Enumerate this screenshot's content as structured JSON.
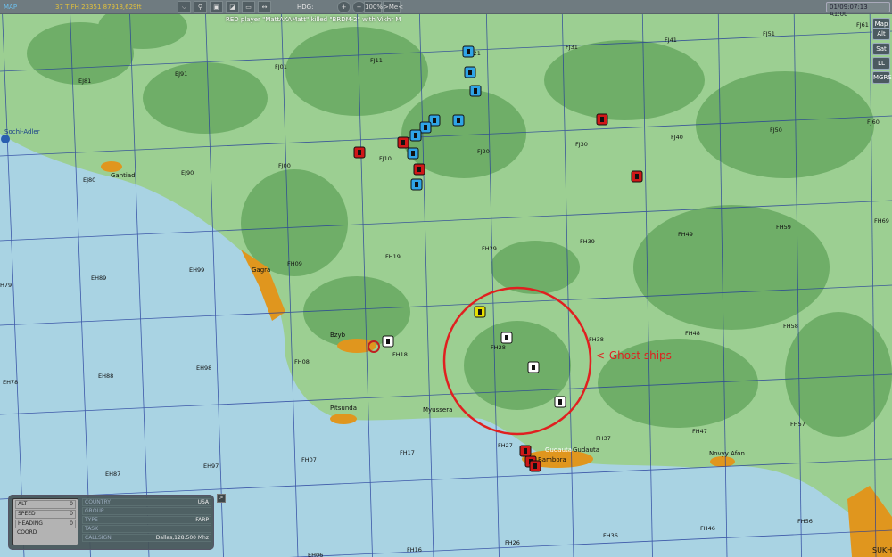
{
  "topbar": {
    "title": "MAP",
    "coords": "37 T FH 23351 87918,629ft",
    "hdg_label": "HDG:",
    "zoom_in": "+",
    "zoom_out": "−",
    "zoom_level": "100%",
    "me_button": ">Me<",
    "clock": "01/09:07:13 A1:00",
    "tools": [
      "ruler-icon",
      "measure-icon",
      "layers-icon",
      "marker-icon",
      "comment-icon",
      "distance-icon"
    ]
  },
  "message": "RED player \"MattAKAMatt\" killed \"BRDM-2\" with Vikhr M",
  "side_buttons": [
    "Map",
    "Alt",
    "Sat",
    "LL",
    "MGRS"
  ],
  "grid_labels": [
    "EJ81",
    "EJ91",
    "FJ01",
    "FJ11",
    "FJ21",
    "FJ31",
    "FJ41",
    "FJ51",
    "FJ61",
    "EJ80",
    "EJ90",
    "FJ00",
    "FJ10",
    "FJ20",
    "FJ30",
    "FJ40",
    "FJ50",
    "FJ60",
    "EH89",
    "EH99",
    "FH09",
    "FH19",
    "FH29",
    "FH39",
    "FH49",
    "FH59",
    "FH69",
    "EH78",
    "EH88",
    "EH98",
    "FH08",
    "FH18",
    "FH28",
    "FH38",
    "FH48",
    "FH58",
    "EH87",
    "EH97",
    "FH07",
    "FH17",
    "FH27",
    "FH37",
    "FH47",
    "FH57",
    "FH56",
    "FH46",
    "FH36",
    "FH26",
    "FH16",
    "EH06",
    "H79"
  ],
  "towns": [
    "Sochi-Adler",
    "Gantiadi",
    "Gagra",
    "Bzyb",
    "Pitsunda",
    "Myussera",
    "Gudauta",
    "Gudauta",
    "Bambora",
    "Novyy Afon",
    "SUKH"
  ],
  "annotation": "<-Ghost ships",
  "colors": {
    "sea": "#a9d3e3",
    "land": "#9ccf92",
    "forest": "#6fae68",
    "town": "#e0961e",
    "blue_unit": "#2fa4e6",
    "red_unit": "#d01818",
    "circle": "#e02020"
  },
  "info_panel": {
    "left": [
      {
        "label": "ALT",
        "value": "0"
      },
      {
        "label": "SPEED",
        "value": "0"
      },
      {
        "label": "HEADING",
        "value": "0"
      },
      {
        "label": "COORD",
        "value": ""
      }
    ],
    "right": [
      {
        "label": "COUNTRY",
        "value": "USA"
      },
      {
        "label": "GROUP",
        "value": ""
      },
      {
        "label": "TYPE",
        "value": "FARP"
      },
      {
        "label": "TASK",
        "value": ""
      },
      {
        "label": "CALLSIGN",
        "value": "Dallas,128.500 Mhz"
      }
    ],
    "expand": ">"
  }
}
